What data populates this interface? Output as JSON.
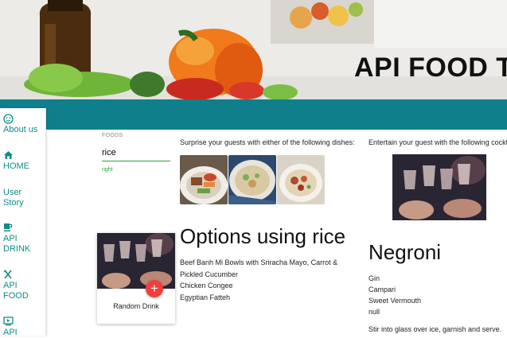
{
  "banner": {
    "title": "API FOOD T"
  },
  "sidebar": {
    "items": [
      {
        "label": "About us",
        "icon": "smile-icon"
      },
      {
        "label": "HOME",
        "icon": "home-icon"
      },
      {
        "label": "User Story",
        "icon": "none"
      },
      {
        "label": "API DRINK",
        "icon": "coffee-cup-icon"
      },
      {
        "label": "API FOOD",
        "icon": "utensils-icon"
      },
      {
        "label": "API",
        "icon": "tv-play-icon"
      }
    ]
  },
  "foods": {
    "label": "FOODS",
    "value": "rice",
    "helper": "right"
  },
  "food_section": {
    "intro": "Surprise your guests with either of the following dishes:",
    "heading": "Options using rice",
    "dishes": [
      "Beef Banh Mi Bowls with Sriracha Mayo, Carrot & Pickled Cucumber",
      "Chicken Congee",
      "Egyptian Fatteh"
    ]
  },
  "drink_section": {
    "intro": "Entertain your guest with the following cocktail",
    "name": "Negroni",
    "ingredients": [
      "Gin",
      "Campari",
      "Sweet Vermouth",
      "null"
    ],
    "instructions": "Stir into glass over ice, garnish and serve."
  },
  "random_card": {
    "label": "Random Drink",
    "fab": "+"
  },
  "colors": {
    "accent": "#0f7f8c",
    "nav_text": "#0f8c86",
    "fab": "#f03e3e",
    "input_underline": "#2e9e3c"
  }
}
